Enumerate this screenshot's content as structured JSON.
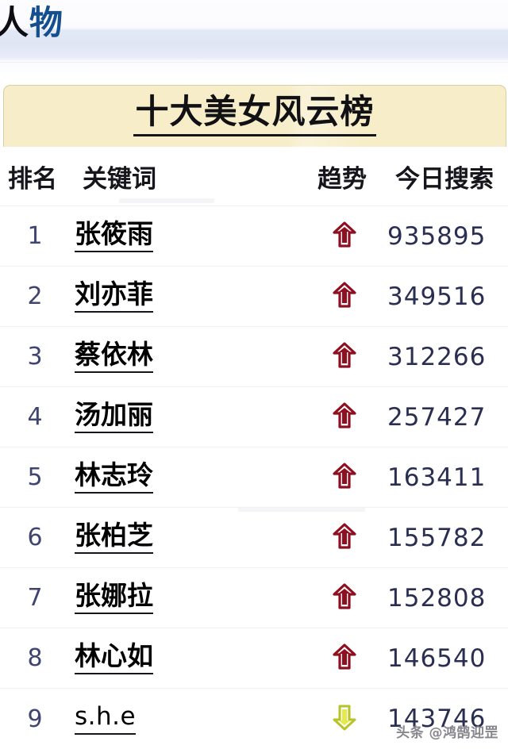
{
  "browser_tab": {
    "label_dark": "人",
    "label_blue": "物"
  },
  "banner": {
    "title": "十大美女风云榜"
  },
  "table": {
    "headers": {
      "rank": "排名",
      "keyword": "关键词",
      "trend": "趋势",
      "searches": "今日搜索"
    },
    "rows": [
      {
        "rank": "1",
        "keyword": "张筱雨",
        "trend": "arrow-up-icon",
        "trend_dir": "up",
        "searches": "935895"
      },
      {
        "rank": "2",
        "keyword": "刘亦菲",
        "trend": "arrow-up-icon",
        "trend_dir": "up",
        "searches": "349516"
      },
      {
        "rank": "3",
        "keyword": "蔡依林",
        "trend": "arrow-up-icon",
        "trend_dir": "up",
        "searches": "312266"
      },
      {
        "rank": "4",
        "keyword": "汤加丽",
        "trend": "arrow-up-icon",
        "trend_dir": "up",
        "searches": "257427"
      },
      {
        "rank": "5",
        "keyword": "林志玲",
        "trend": "arrow-up-icon",
        "trend_dir": "up",
        "searches": "163411"
      },
      {
        "rank": "6",
        "keyword": "张柏芝",
        "trend": "arrow-up-icon",
        "trend_dir": "up",
        "searches": "155782"
      },
      {
        "rank": "7",
        "keyword": "张娜拉",
        "trend": "arrow-up-icon",
        "trend_dir": "up",
        "searches": "152808"
      },
      {
        "rank": "8",
        "keyword": "林心如",
        "trend": "arrow-up-icon",
        "trend_dir": "up",
        "searches": "146540"
      },
      {
        "rank": "9",
        "keyword": "s.h.e",
        "trend": "arrow-down-icon",
        "trend_dir": "down",
        "searches": "143746"
      }
    ]
  },
  "watermark": {
    "text": "头条 @鸿鹄迎罡"
  },
  "colors": {
    "banner_bg": "#f7edc8",
    "rank_text": "#3f4470",
    "count_text": "#2a2f52",
    "arrow_up": "#8e1020",
    "arrow_down": "#e3ea4a",
    "tab_blue": "#14508f"
  }
}
